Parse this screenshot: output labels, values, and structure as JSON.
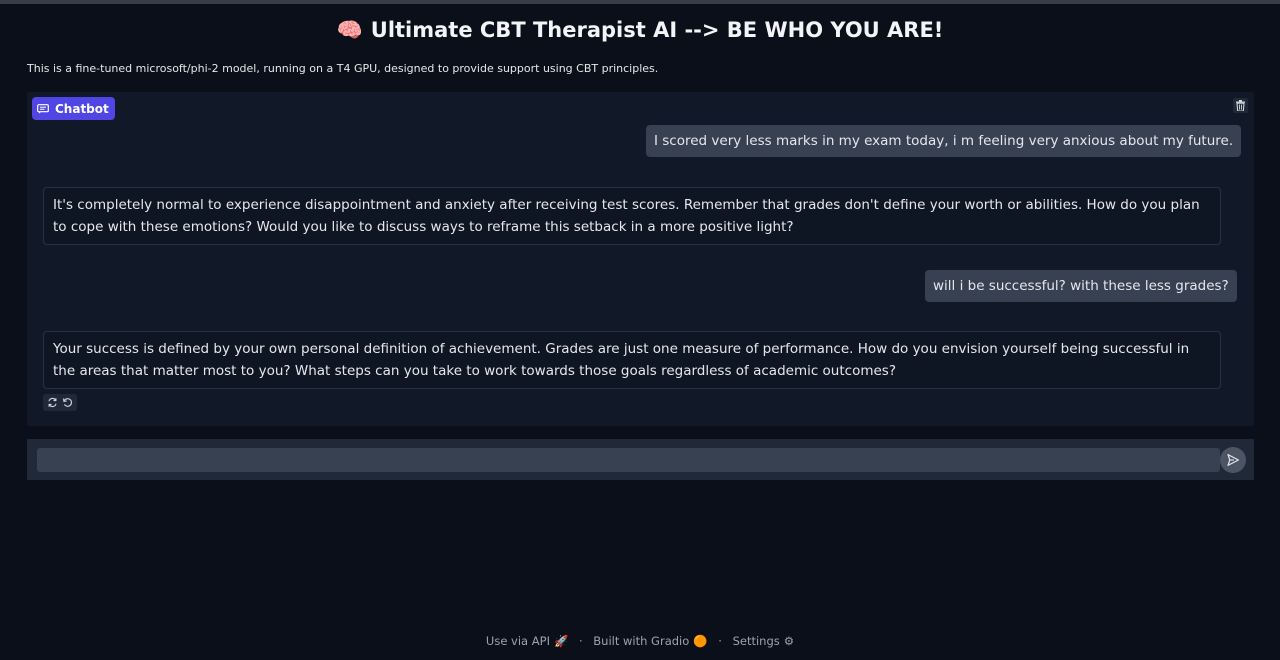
{
  "header": {
    "brain_icon": "🧠",
    "title": "Ultimate CBT Therapist AI --> BE WHO YOU ARE!",
    "description": "This is a fine-tuned microsoft/phi-2 model, running on a T4 GPU, designed to provide support using CBT principles."
  },
  "chatbot": {
    "label": "Chatbot",
    "badge_icon": "chat-bubble-icon",
    "clear_icon": "trash-icon",
    "messages": [
      {
        "role": "user",
        "text": "I scored very less marks in my exam today, i m feeling very anxious about my future."
      },
      {
        "role": "bot",
        "text": "It's completely normal to experience disappointment and anxiety after receiving test scores. Remember that grades don't define your worth or abilities. How do you plan to cope with these emotions? Would you like to discuss ways to reframe this setback in a more positive light?"
      },
      {
        "role": "user",
        "text": "will i be successful? with these less grades?"
      },
      {
        "role": "bot",
        "text": "Your success is defined by your own personal definition of achievement. Grades are just one measure of performance. How do you envision yourself being successful in the areas that matter most to you? What steps can you take to work towards those goals regardless of academic outcomes?"
      }
    ],
    "actions": [
      "retry-icon",
      "undo-icon"
    ]
  },
  "input": {
    "value": "",
    "placeholder": "",
    "submit_icon": "send-icon"
  },
  "footer": {
    "api_label": "Use via API",
    "api_icon": "🚀",
    "separator": "·",
    "built_label": "Built with Gradio",
    "gradio_icon": "🟠",
    "settings_label": "Settings",
    "settings_icon": "⚙"
  },
  "colors": {
    "background": "#0b0f19",
    "panel": "#111827",
    "accent": "#4f46e5",
    "user_bubble": "#374151"
  }
}
